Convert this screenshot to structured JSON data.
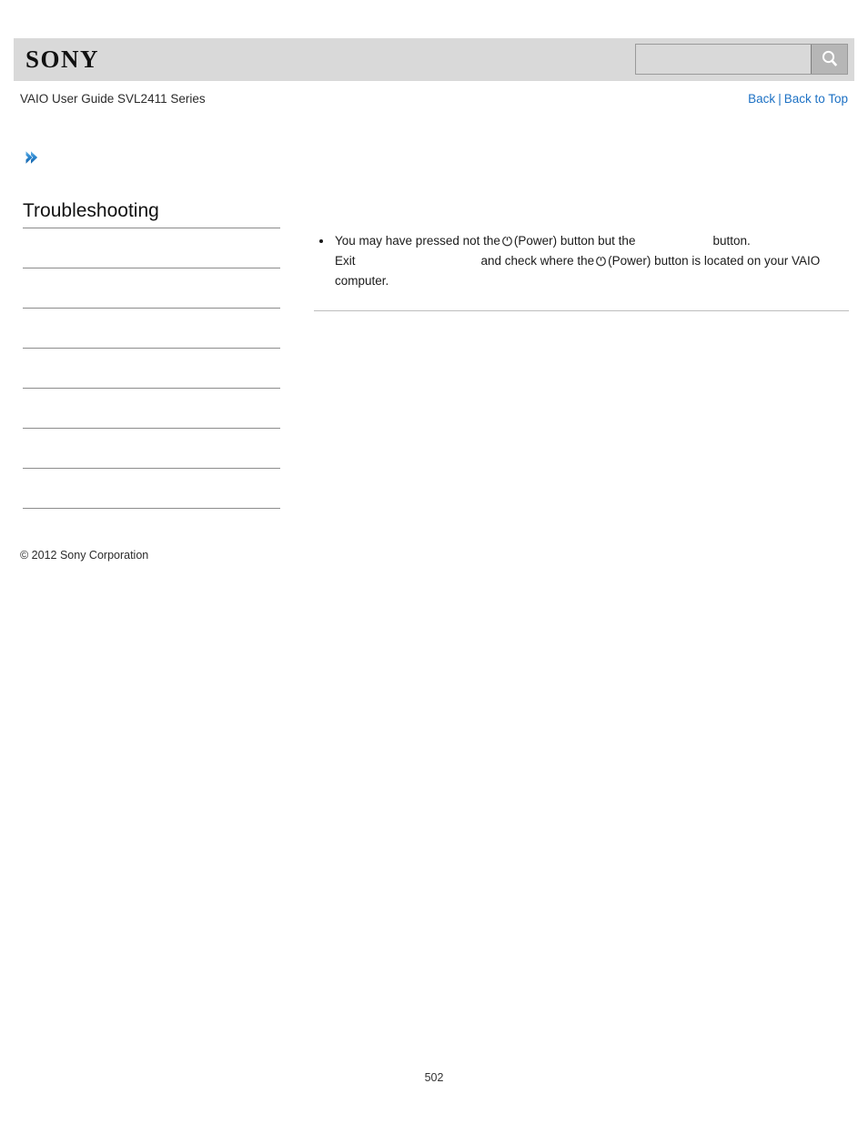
{
  "header": {
    "logo_text": "SONY",
    "logo_icon": "sony-wordmark",
    "search": {
      "value": "",
      "placeholder": "",
      "button_icon": "search-icon"
    }
  },
  "subheader": {
    "guide_title": "VAIO User Guide SVL2411 Series",
    "links": {
      "back": "Back",
      "separator": "|",
      "back_to_top": "Back to Top"
    }
  },
  "breadcrumb": {
    "icon": "chevron-right-icon"
  },
  "sidebar": {
    "title": "Troubleshooting",
    "items": [
      {
        "label": ""
      },
      {
        "label": ""
      },
      {
        "label": ""
      },
      {
        "label": ""
      },
      {
        "label": ""
      },
      {
        "label": ""
      },
      {
        "label": ""
      }
    ],
    "copyright": "© 2012 Sony Corporation"
  },
  "main": {
    "bullets": [
      {
        "seg1": "You may have pressed not the",
        "power_icon_1": "power-icon",
        "seg2": "(Power) button but the",
        "seg3": "button.",
        "seg4": "Exit",
        "seg5": "and check where the",
        "power_icon_2": "power-icon",
        "seg6": "(Power) button is located on your VAIO computer."
      }
    ]
  },
  "footer": {
    "page_number": "502"
  },
  "colors": {
    "header_band": "#d9d9d9",
    "link": "#1d71c4",
    "rule": "#8c8c8c",
    "accent_chevron": "#2a86d0"
  }
}
